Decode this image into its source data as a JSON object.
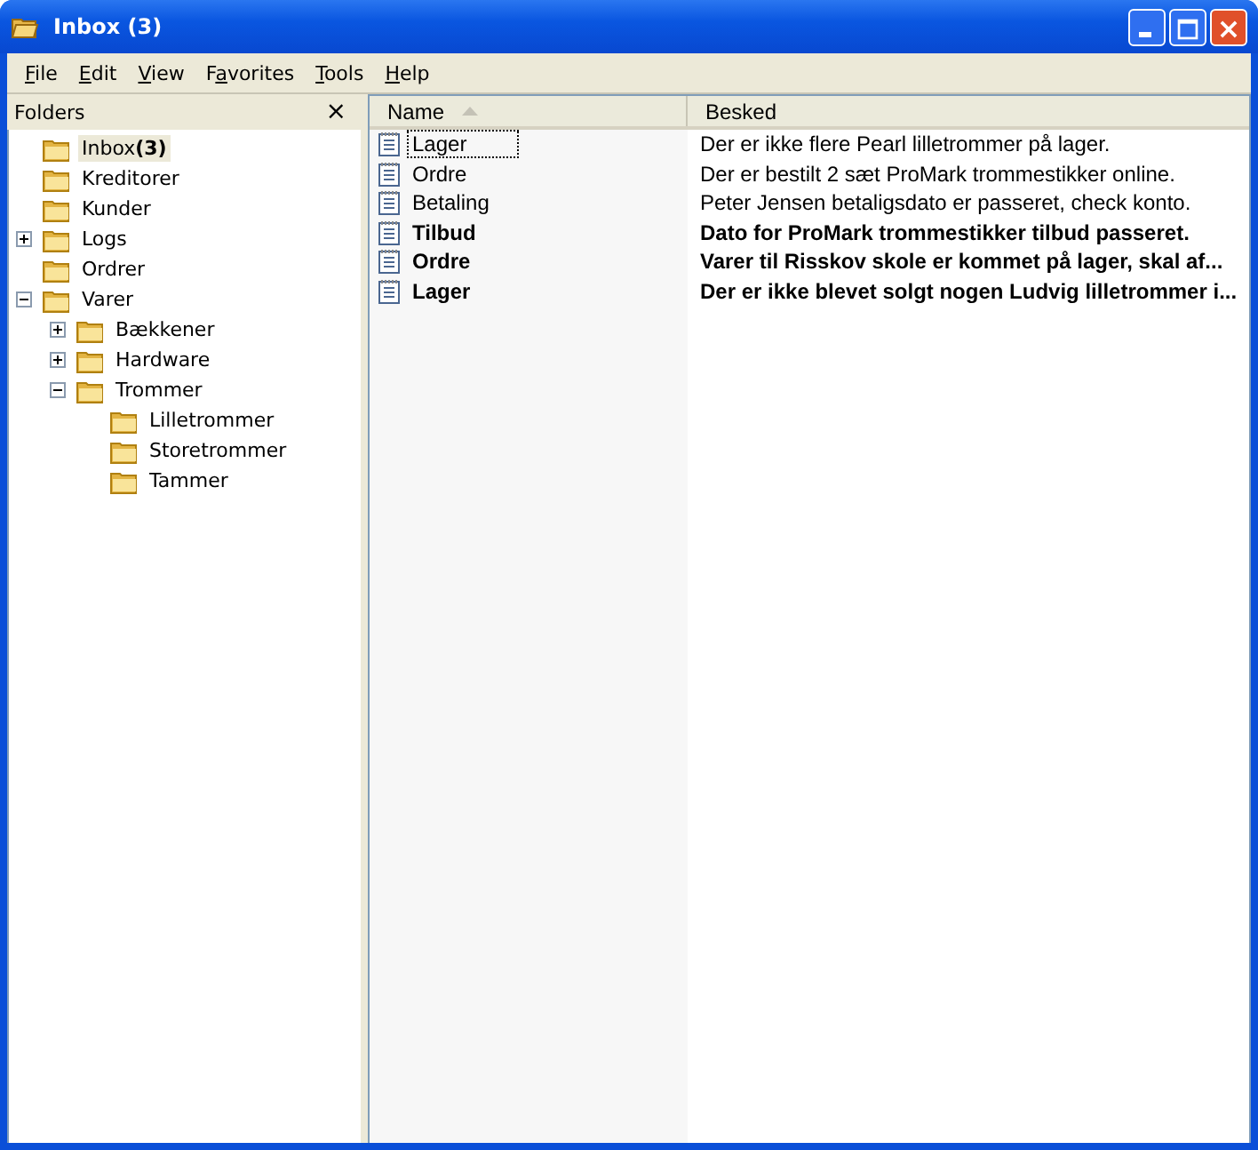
{
  "window": {
    "title": "Inbox (3)"
  },
  "menu": [
    {
      "accel": "F",
      "post": "ile"
    },
    {
      "accel": "E",
      "post": "dit"
    },
    {
      "accel": "V",
      "post": "iew"
    },
    {
      "pre": "F",
      "accel": "a",
      "post": "vorites"
    },
    {
      "accel": "T",
      "post": "ools"
    },
    {
      "accel": "H",
      "post": "elp"
    }
  ],
  "folders_pane": {
    "title": "Folders",
    "close": "×",
    "tree": [
      {
        "name": "Inbox",
        "count": "(3)",
        "selected": true
      },
      {
        "name": "Kreditorer",
        "selected": false
      },
      {
        "name": "Kunder",
        "selected": false
      },
      {
        "name": "Logs",
        "selected": false,
        "expanded": false
      },
      {
        "name": "Ordrer",
        "selected": false
      },
      {
        "name": "Varer",
        "selected": false,
        "expanded": true,
        "children": [
          {
            "name": "Bækkener",
            "selected": false,
            "expanded": false
          },
          {
            "name": "Hardware",
            "selected": false,
            "expanded": false
          },
          {
            "name": "Trommer",
            "selected": false,
            "expanded": true,
            "children": [
              {
                "name": "Lilletrommer",
                "selected": false
              },
              {
                "name": "Storetrommer",
                "selected": false
              },
              {
                "name": "Tammer",
                "selected": false
              }
            ]
          }
        ]
      }
    ]
  },
  "table": {
    "columns": [
      "Name",
      "Besked"
    ],
    "rows": [
      {
        "name": "Lager",
        "message": "Der er ikke flere Pearl lilletrommer på lager.",
        "unread": false,
        "selected": true
      },
      {
        "name": "Ordre",
        "message": "Der er bestilt 2 sæt ProMark trommestikker online.",
        "unread": false,
        "selected": false
      },
      {
        "name": "Betaling",
        "message": "Peter Jensen betaligsdato er passeret, check konto.",
        "unread": false,
        "selected": false
      },
      {
        "name": "Tilbud",
        "message": "Dato for ProMark trommestikker tilbud passeret.",
        "unread": true,
        "selected": false
      },
      {
        "name": "Ordre",
        "message": "Varer til Risskov skole er kommet på lager, skal af...",
        "unread": true,
        "selected": false
      },
      {
        "name": "Lager",
        "message": "Der er ikke blevet solgt nogen Ludvig lilletrommer i...",
        "unread": true,
        "selected": false
      }
    ]
  }
}
